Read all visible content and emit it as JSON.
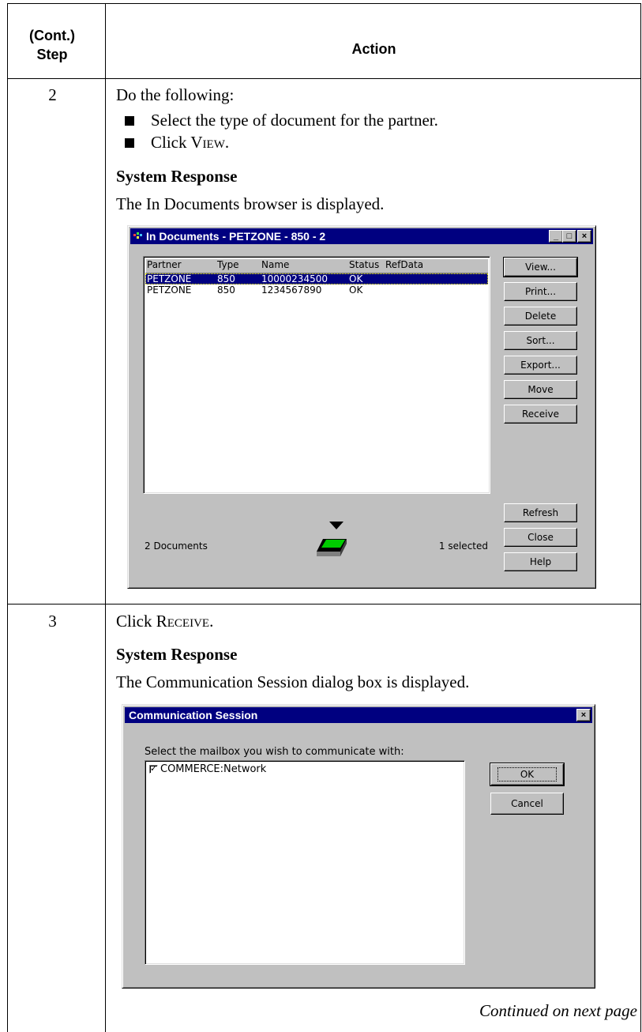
{
  "table": {
    "header": {
      "step_line1": "(Cont.)",
      "step_line2": "Step",
      "action": "Action"
    },
    "row2": {
      "step": "2",
      "intro": "Do the following:",
      "bullets": [
        "Select the type of document for the partner.",
        {
          "prefix": "Click ",
          "cap": "V",
          "rest": "IEW",
          "suffix": "."
        }
      ],
      "system_response_label": "System Response",
      "response_text": "The In Documents browser is displayed."
    },
    "row3": {
      "step": "3",
      "instruction": {
        "prefix": "Click ",
        "cap": "R",
        "rest": "ECEIVE",
        "suffix": "."
      },
      "system_response_label": "System Response",
      "response_text": "The Communication Session dialog box is displayed.",
      "continued": "Continued on next page"
    }
  },
  "in_documents_window": {
    "title": "In Documents - PETZONE - 850 - 2",
    "columns": [
      "Partner",
      "Type",
      "Name",
      "Status",
      "RefData"
    ],
    "rows": [
      {
        "partner": "PETZONE",
        "type": "850",
        "name": "10000234500",
        "status": "OK",
        "refdata": "",
        "selected": true
      },
      {
        "partner": "PETZONE",
        "type": "850",
        "name": "1234567890",
        "status": "OK",
        "refdata": "",
        "selected": false
      }
    ],
    "buttons": [
      "View...",
      "Print...",
      "Delete",
      "Sort...",
      "Export...",
      "Move",
      "Receive",
      "Refresh",
      "Close",
      "Help"
    ],
    "doc_count": "2 Documents",
    "selected_count": "1 selected",
    "title_controls": {
      "minimize": "_",
      "maximize": "□",
      "close": "×"
    }
  },
  "comm_session_dialog": {
    "title": "Communication Session",
    "prompt": "Select the mailbox you wish to communicate with:",
    "mailboxes": [
      {
        "label": "COMMERCE:Network",
        "checked": true,
        "check_glyph": "✓"
      }
    ],
    "ok_label": "OK",
    "cancel_label": "Cancel",
    "close_glyph": "×"
  },
  "colors": {
    "titlebar": "#000080",
    "dialog_face": "#c0c0c0",
    "inbox_icon_green": "#00cc00"
  }
}
